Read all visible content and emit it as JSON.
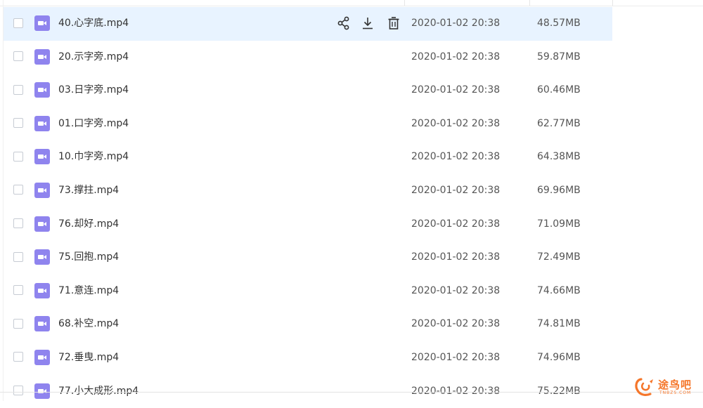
{
  "file_list": {
    "rows": [
      {
        "name": "40.心字底.mp4",
        "date": "2020-01-02 20:38",
        "size": "48.57MB",
        "hovered": true
      },
      {
        "name": "20.示字旁.mp4",
        "date": "2020-01-02 20:38",
        "size": "59.87MB"
      },
      {
        "name": "03.日字旁.mp4",
        "date": "2020-01-02 20:38",
        "size": "60.46MB"
      },
      {
        "name": "01.口字旁.mp4",
        "date": "2020-01-02 20:38",
        "size": "62.77MB"
      },
      {
        "name": "10.巾字旁.mp4",
        "date": "2020-01-02 20:38",
        "size": "64.38MB"
      },
      {
        "name": "73.撑拄.mp4",
        "date": "2020-01-02 20:38",
        "size": "69.96MB"
      },
      {
        "name": "76.却好.mp4",
        "date": "2020-01-02 20:38",
        "size": "71.09MB"
      },
      {
        "name": "75.回抱.mp4",
        "date": "2020-01-02 20:38",
        "size": "72.49MB"
      },
      {
        "name": "71.意连.mp4",
        "date": "2020-01-02 20:38",
        "size": "74.66MB"
      },
      {
        "name": "68.补空.mp4",
        "date": "2020-01-02 20:38",
        "size": "74.81MB"
      },
      {
        "name": "72.垂曳.mp4",
        "date": "2020-01-02 20:38",
        "size": "74.96MB"
      },
      {
        "name": "77.小大成形.mp4",
        "date": "2020-01-02 20:38",
        "size": "75.22MB"
      }
    ],
    "file_icon": "video-file-icon",
    "row_actions": [
      "share-icon",
      "download-icon",
      "delete-icon"
    ]
  },
  "watermark": {
    "text": "途鸟吧",
    "sub": "TNBZS.COM"
  },
  "colors": {
    "hover_row": "#e8f3ff",
    "file_icon": "#8f84ee",
    "watermark": "#f5762a"
  }
}
